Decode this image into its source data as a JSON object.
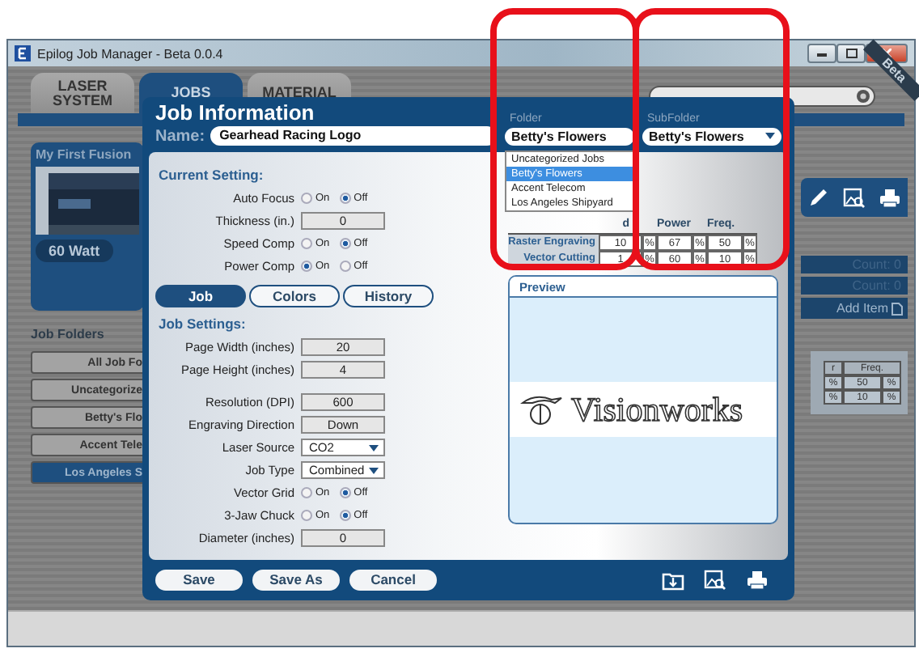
{
  "window": {
    "title": "Epilog Job Manager - Beta 0.0.4"
  },
  "badge": "Beta",
  "tabs": [
    {
      "label": "LASER SYSTEM",
      "selected": false
    },
    {
      "label": "JOBS",
      "selected": true
    },
    {
      "label": "MATERIAL",
      "selected": false
    }
  ],
  "machine": {
    "name": "My First Fusion",
    "power": "60 Watt"
  },
  "folders": {
    "title": "Job Folders",
    "items": [
      {
        "label": "All Job Fo",
        "selected": false
      },
      {
        "label": "Uncategorize",
        "selected": false
      },
      {
        "label": "Betty's Flo",
        "selected": false
      },
      {
        "label": "Accent Tele",
        "selected": false
      },
      {
        "label": "Los Angeles S",
        "selected": true
      }
    ]
  },
  "right_panel": {
    "counts": [
      "Count: 0",
      "Count: 0"
    ],
    "add_item": "Add Item",
    "table": {
      "headers": [
        "r",
        "Freq."
      ],
      "rows": [
        [
          "%",
          "50",
          "%"
        ],
        [
          "%",
          "10",
          "%"
        ]
      ]
    }
  },
  "dialog": {
    "title": "Job Information",
    "name_label": "Name:",
    "name": "Gearhead Racing Logo",
    "folder": {
      "label": "Folder",
      "value": "Betty's Flowers",
      "options": [
        {
          "label": "Uncategorized Jobs",
          "selected": false
        },
        {
          "label": "Betty's Flowers",
          "selected": true
        },
        {
          "label": "Accent Telecom",
          "selected": false
        },
        {
          "label": "Los Angeles Shipyard",
          "selected": false
        }
      ]
    },
    "subfolder": {
      "label": "SubFolder",
      "value": "Betty's Flowers"
    },
    "current_setting": {
      "title": "Current Setting:",
      "rows": [
        {
          "kind": "radio",
          "label": "Auto Focus",
          "on_label": "On",
          "off_label": "Off",
          "on": false
        },
        {
          "kind": "field",
          "label": "Thickness (in.)",
          "value": "0"
        },
        {
          "kind": "radio",
          "label": "Speed Comp",
          "on_label": "On",
          "off_label": "Off",
          "on": false
        },
        {
          "kind": "radio",
          "label": "Power Comp",
          "on_label": "On",
          "off_label": "Off",
          "on": true
        }
      ]
    },
    "tabs": [
      {
        "label": "Job",
        "selected": true
      },
      {
        "label": "Colors",
        "selected": false
      },
      {
        "label": "History",
        "selected": false
      }
    ],
    "job_settings": {
      "title": "Job Settings:",
      "groups": [
        [
          {
            "kind": "field",
            "label": "Page Width (inches)",
            "value": "20"
          },
          {
            "kind": "field",
            "label": "Page Height (inches)",
            "value": "4"
          }
        ],
        [
          {
            "kind": "field",
            "label": "Resolution (DPI)",
            "value": "600"
          },
          {
            "kind": "field",
            "label": "Engraving Direction",
            "value": "Down"
          },
          {
            "kind": "select",
            "label": "Laser Source",
            "value": "CO2"
          },
          {
            "kind": "select",
            "label": "Job Type",
            "value": "Combined"
          },
          {
            "kind": "radio",
            "label": "Vector Grid",
            "on_label": "On",
            "off_label": "Off",
            "on": false
          },
          {
            "kind": "radio",
            "label": "3-Jaw Chuck",
            "on_label": "On",
            "off_label": "Off",
            "on": false
          },
          {
            "kind": "field",
            "label": "Diameter (inches)",
            "value": "0"
          }
        ]
      ]
    },
    "process_table": {
      "columns": [
        "d",
        "",
        "Power",
        "",
        "Freq.",
        ""
      ],
      "rows": [
        {
          "label": "Raster Engraving",
          "cells": [
            "10",
            "%",
            "67",
            "%",
            "50",
            "%"
          ]
        },
        {
          "label": "Vector Cutting",
          "cells": [
            "1",
            "%",
            "60",
            "%",
            "10",
            "%"
          ]
        }
      ]
    },
    "preview": {
      "title": "Preview",
      "logo_text": "Visionworks"
    },
    "buttons": [
      "Save",
      "Save As",
      "Cancel"
    ]
  }
}
